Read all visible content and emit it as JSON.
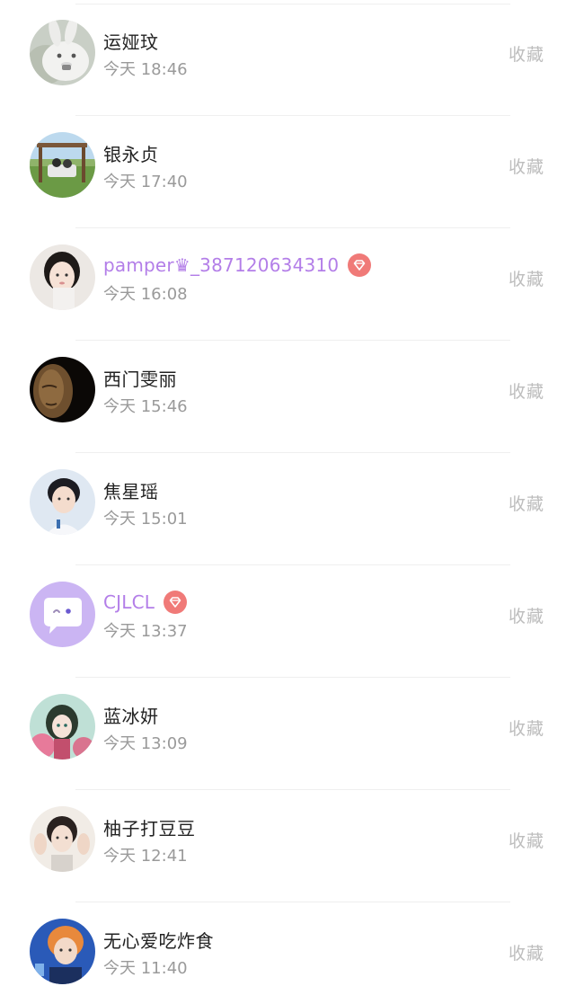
{
  "feed": {
    "items": [
      {
        "name": "运娅玟",
        "time": "今天 18:46",
        "action": "收藏",
        "avatar": "white-rabbit-avatar",
        "vip": false
      },
      {
        "name": "银永贞",
        "time": "今天 17:40",
        "action": "收藏",
        "avatar": "swing-field-avatar",
        "vip": false
      },
      {
        "name": "pamper♛_387120634310",
        "time": "今天 16:08",
        "action": "收藏",
        "avatar": "girl-portrait-avatar",
        "vip": true
      },
      {
        "name": "西门雯丽",
        "time": "今天 15:46",
        "action": "收藏",
        "avatar": "buddha-face-avatar",
        "vip": false
      },
      {
        "name": "焦星瑶",
        "time": "今天 15:01",
        "action": "收藏",
        "avatar": "boy-portrait-avatar",
        "vip": false
      },
      {
        "name": "CJLCL",
        "time": "今天 13:37",
        "action": "收藏",
        "avatar": "chat-bubble-avatar",
        "vip": true
      },
      {
        "name": "蓝冰妍",
        "time": "今天 13:09",
        "action": "收藏",
        "avatar": "anime-girl-avatar",
        "vip": false
      },
      {
        "name": "柚子打豆豆",
        "time": "今天 12:41",
        "action": "收藏",
        "avatar": "girl-hands-avatar",
        "vip": false
      },
      {
        "name": "无心爱吃炸食",
        "time": "今天 11:40",
        "action": "收藏",
        "avatar": "orange-hair-avatar",
        "vip": false
      }
    ]
  },
  "colors": {
    "vip_name": "#b37ee8",
    "vip_badge": "#f07a78",
    "time_text": "#9a9a9a",
    "collect_text": "#bdbdbd"
  }
}
